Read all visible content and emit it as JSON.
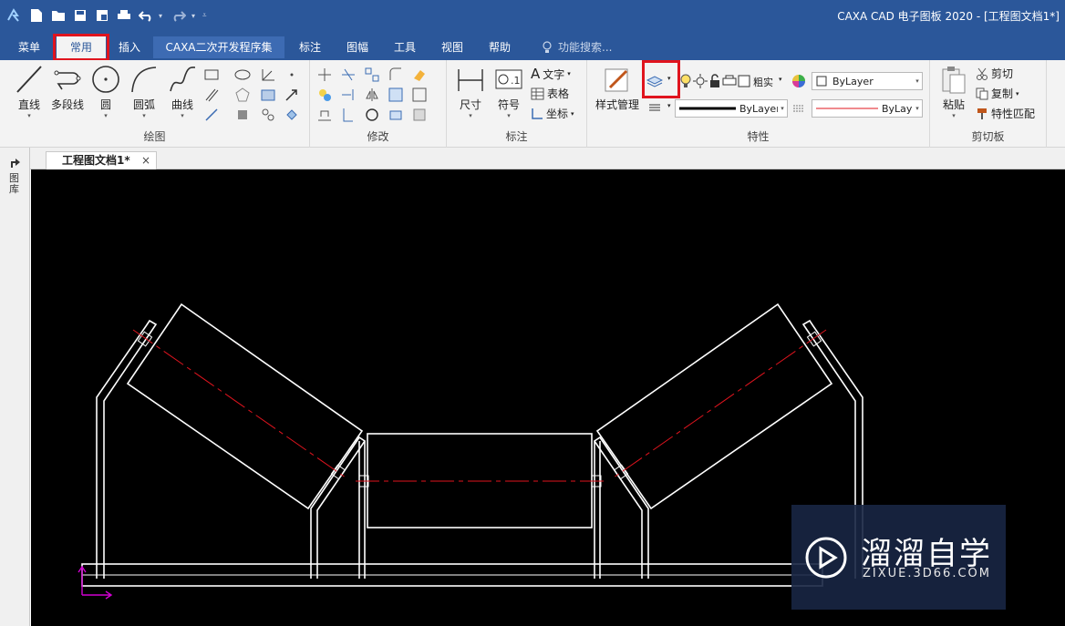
{
  "window": {
    "title": "CAXA CAD 电子图板 2020 - [工程图文档1*]"
  },
  "ribbon_tabs": [
    {
      "label": "菜单"
    },
    {
      "label": "常用"
    },
    {
      "label": "插入"
    },
    {
      "label": "CAXA二次开发程序集"
    },
    {
      "label": "标注"
    },
    {
      "label": "图幅"
    },
    {
      "label": "工具"
    },
    {
      "label": "视图"
    },
    {
      "label": "帮助"
    }
  ],
  "active_tab": "常用",
  "search": {
    "placeholder": "功能搜索..."
  },
  "groups": {
    "draw": {
      "label": "绘图",
      "buttons": [
        "直线",
        "多段线",
        "圆",
        "圆弧",
        "曲线"
      ]
    },
    "modify": {
      "label": "修改"
    },
    "annotate": {
      "label": "标注",
      "buttons": [
        "尺寸",
        "符号"
      ],
      "small": [
        "文字",
        "表格",
        "坐标"
      ]
    },
    "properties": {
      "label": "特性",
      "style_button": "样式管理",
      "lineweight_value": "粗实",
      "color_value": "ByLayer",
      "linetype_value": "ByLayer",
      "linestyle_value": "ByLayer"
    },
    "clipboard": {
      "label": "剪切板",
      "paste": "粘贴",
      "small": [
        "剪切",
        "复制",
        "特性匹配"
      ]
    }
  },
  "document_tab": {
    "label": "工程图文档1*",
    "close": "×"
  },
  "left_panel": {
    "label": "图库"
  },
  "watermark": {
    "title": "溜溜自学",
    "subtitle": "ZIXUE.3D66.COM"
  },
  "colors": {
    "title_bar": "#2b579a",
    "canvas": "#000000",
    "drawing_lines": "#ffffff",
    "center_lines": "#e0141e",
    "axis_marker": "#d100d1",
    "highlight": "#e0141e"
  }
}
